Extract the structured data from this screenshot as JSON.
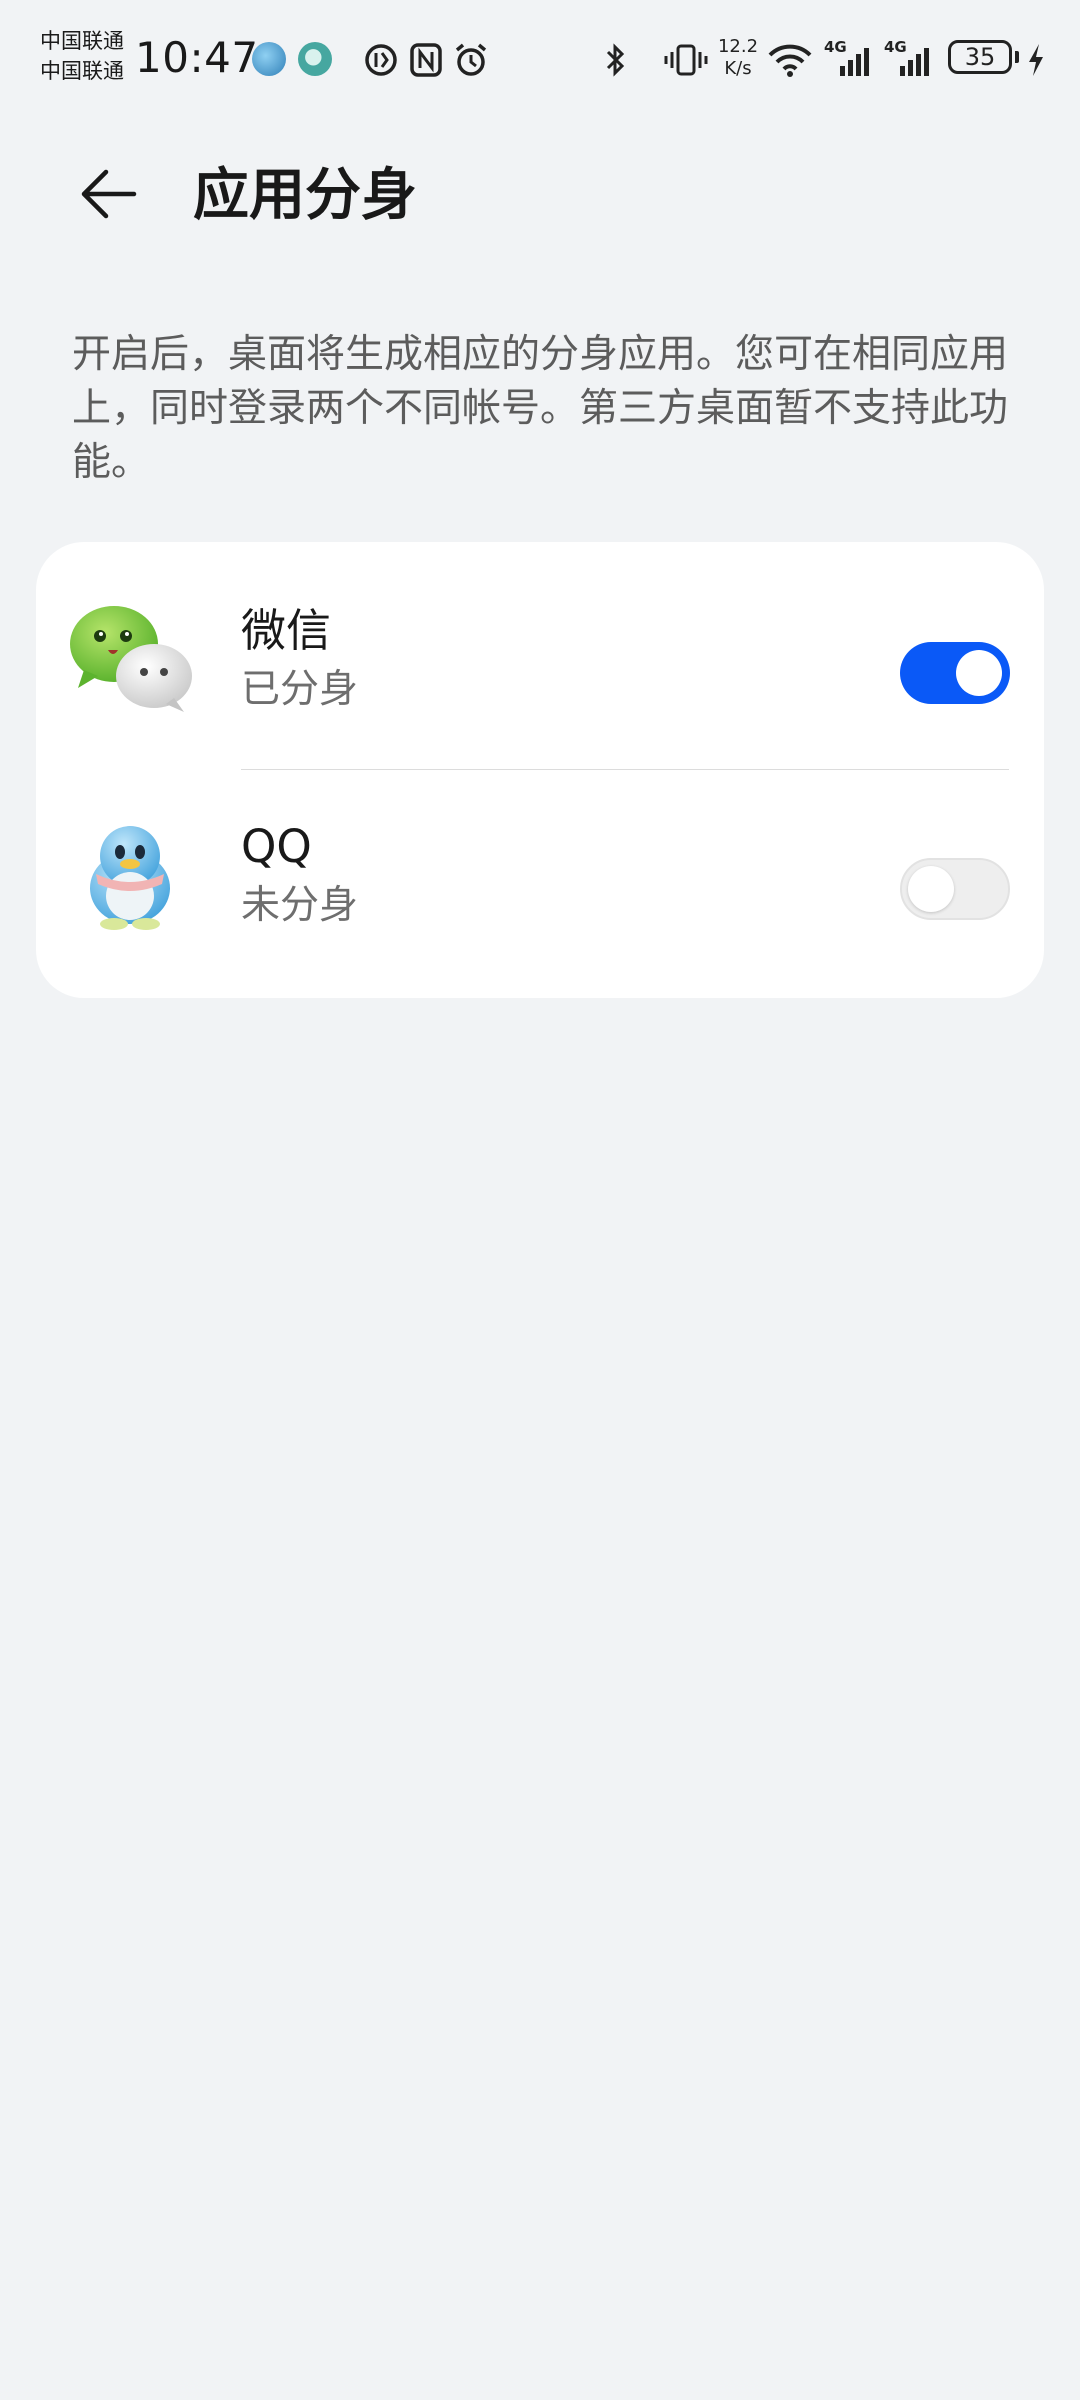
{
  "status_bar": {
    "carrier_1": "中国联通",
    "carrier_2": "中国联通",
    "time": "10:47",
    "network_speed_value": "12.2",
    "network_speed_unit": "K/s",
    "signal_1_label": "4G",
    "signal_2_label": "4G",
    "battery_level": "35",
    "icons": [
      "app-notification-icon",
      "app-notification-icon",
      "nfc-alt-icon",
      "nfc-icon",
      "alarm-icon",
      "bluetooth-icon",
      "vibrate-icon",
      "wifi-icon",
      "cellular-signal-icon",
      "cellular-signal-icon",
      "battery-icon",
      "charging-icon"
    ]
  },
  "header": {
    "back_icon": "back-arrow-icon",
    "title": "应用分身"
  },
  "description": "开启后，桌面将生成相应的分身应用。您可在相同应用上，同时登录两个不同帐号。第三方桌面暂不支持此功能。",
  "apps": [
    {
      "name": "微信",
      "status": "已分身",
      "enabled": true,
      "icon": "wechat-icon"
    },
    {
      "name": "QQ",
      "status": "未分身",
      "enabled": false,
      "icon": "qq-penguin-icon"
    }
  ],
  "colors": {
    "background": "#f1f3f5",
    "card": "#ffffff",
    "accent": "#0a59f7",
    "toggle_off": "#eeeeee"
  }
}
